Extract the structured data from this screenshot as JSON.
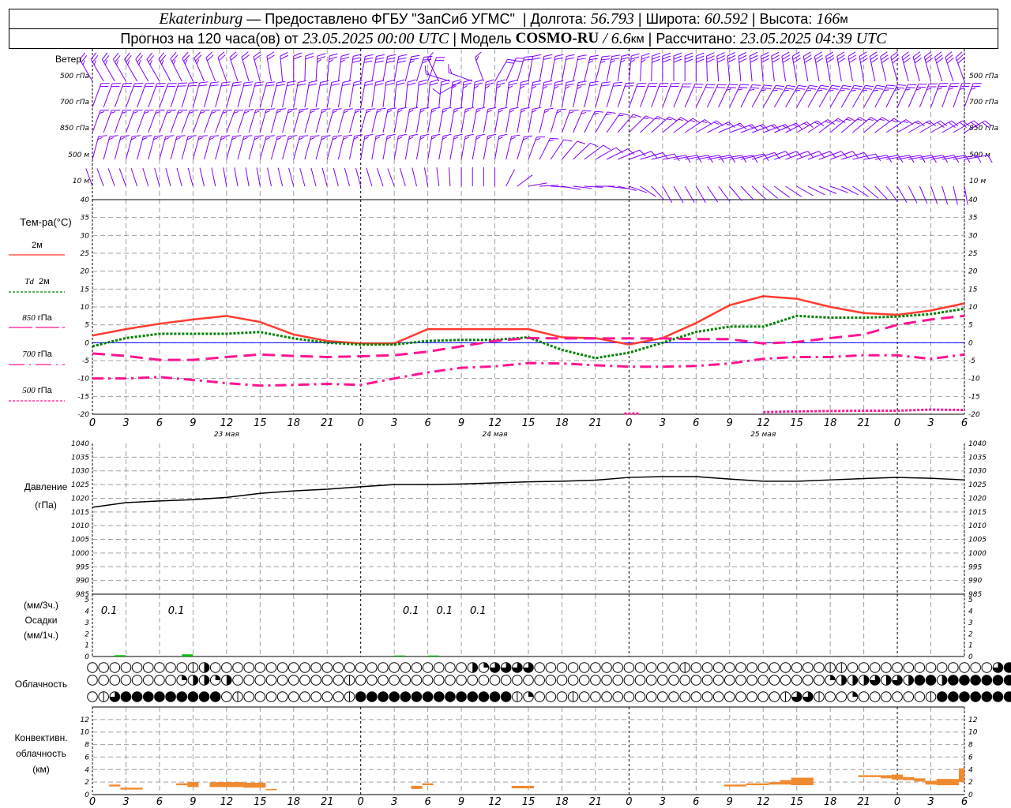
{
  "header": {
    "city": "Ekaterinburg",
    "provider": " — Предоставлено ФГБУ \"ЗапСиб УГМС\" ",
    "sep": " | ",
    "lon_label": "Долгота: ",
    "lon": "56.793",
    "lat_label": "Широта: ",
    "lat": "60.592",
    "alt_label": "Высота: ",
    "alt": "166",
    "alt_unit": "м",
    "forecast_prefix": "Прогноз на 120 часа(ов) от ",
    "forecast_start": "23.05.2025 00:00 UTC",
    "model_label": "Модель ",
    "model": "COSMO-RU",
    "model_sep": " / ",
    "resolution": "6.6",
    "res_unit": "км",
    "calc_label": "Рассчитано: ",
    "calc_time": "23.05.2025 04:39 UTC"
  },
  "colors": {
    "wind": "#8000ff",
    "t2m": "#ff3b2f",
    "td2m": "#008000",
    "t850": "#ff1493",
    "t700": "#ff1493",
    "t500": "#ff1493",
    "zero_line": "#0000ff",
    "precip": "#00c000",
    "convective": "#f08a30",
    "grid": "#a0a0a0"
  },
  "time_axis": {
    "hour_range": [
      0,
      78
    ],
    "tick_hours": [
      0,
      3,
      6,
      9,
      12,
      15,
      18,
      21,
      24,
      27,
      30,
      33,
      36,
      39,
      42,
      45,
      48,
      51,
      54,
      57,
      60,
      63,
      66,
      69,
      72,
      75,
      78
    ],
    "tick_labels": [
      "0",
      "3",
      "6",
      "9",
      "12",
      "15",
      "18",
      "21",
      "0",
      "3",
      "6",
      "9",
      "12",
      "15",
      "18",
      "21",
      "0",
      "3",
      "6",
      "9",
      "12",
      "15",
      "18",
      "21",
      "0",
      "3",
      "6"
    ],
    "day_boundaries": [
      24,
      48,
      72
    ],
    "days": [
      {
        "label": "23 мая",
        "hour": 12
      },
      {
        "label": "24 мая",
        "hour": 36
      },
      {
        "label": "25 мая",
        "hour": 60
      }
    ]
  },
  "wind": {
    "title": "Ветер",
    "levels": [
      {
        "label": "500 гПа",
        "dir": [
          330,
          330,
          330,
          335,
          340,
          345,
          0,
          5,
          10,
          10,
          20,
          240,
          30,
          10,
          10,
          15,
          5,
          0,
          0,
          355,
          355,
          350,
          350,
          350,
          345,
          345,
          340
        ],
        "feathers": [
          2.5,
          2.5,
          2.5,
          2.5,
          2,
          2,
          2,
          2.5,
          3,
          3,
          2,
          1,
          2,
          2,
          2,
          2.5,
          2.5,
          3,
          3,
          3,
          3,
          3,
          3,
          3,
          3,
          3,
          3
        ]
      },
      {
        "label": "700 гПа",
        "dir": [
          20,
          20,
          20,
          15,
          15,
          15,
          10,
          10,
          10,
          5,
          5,
          5,
          5,
          10,
          10,
          15,
          20,
          20,
          25,
          25,
          30,
          30,
          30,
          30,
          25,
          20,
          20
        ],
        "feathers": [
          2,
          2,
          2,
          2,
          2,
          2,
          2,
          2,
          2,
          2,
          2,
          2.5,
          2.5,
          2.5,
          2.5,
          2,
          2,
          2,
          2,
          2.5,
          2.5,
          2.5,
          2.5,
          2.5,
          2.5,
          2.5,
          2.5
        ]
      },
      {
        "label": "850 гПа",
        "dir": [
          20,
          20,
          20,
          20,
          20,
          15,
          15,
          15,
          15,
          10,
          10,
          10,
          10,
          10,
          20,
          30,
          45,
          50,
          60,
          70,
          70,
          60,
          50,
          50,
          60,
          60,
          60
        ],
        "feathers": [
          1.5,
          1.5,
          1.5,
          1.5,
          1.5,
          1.5,
          1.5,
          1.5,
          1.5,
          1.5,
          1.5,
          1.5,
          1.5,
          1.5,
          1.5,
          1.5,
          1.5,
          1.5,
          1.5,
          1.5,
          1.5,
          1.5,
          1.5,
          1.5,
          1.5,
          2,
          2
        ]
      },
      {
        "label": "500 м",
        "dir": [
          15,
          15,
          15,
          15,
          15,
          15,
          15,
          15,
          10,
          10,
          10,
          10,
          10,
          20,
          40,
          60,
          70,
          80,
          80,
          80,
          70,
          70,
          70,
          80,
          80,
          80,
          80
        ],
        "feathers": [
          1.5,
          1.5,
          1.5,
          1.5,
          1.5,
          1.5,
          1.5,
          1.5,
          1.5,
          1.5,
          1.5,
          1.5,
          1.5,
          1.5,
          1,
          1,
          1,
          1,
          1,
          1,
          1,
          1,
          1,
          1,
          1,
          1,
          1
        ]
      },
      {
        "label": "10 м",
        "dir": [
          340,
          340,
          345,
          345,
          350,
          350,
          345,
          345,
          345,
          340,
          350,
          0,
          0,
          80,
          100,
          90,
          110,
          150,
          150,
          140,
          130,
          120,
          110,
          130,
          150,
          160,
          170
        ],
        "feathers": [
          0,
          0,
          0,
          0,
          0,
          0,
          0,
          0,
          0,
          0,
          0,
          0,
          0,
          0,
          0,
          0,
          0,
          0,
          0,
          0,
          0,
          0,
          0,
          0,
          0,
          0,
          0
        ]
      }
    ]
  },
  "chart_data": [
    {
      "type": "line",
      "title": "Тем-ра(°C)",
      "ylim": [
        -20,
        40
      ],
      "yticks": [
        -20,
        -15,
        -10,
        -5,
        0,
        5,
        10,
        15,
        20,
        25,
        30,
        35,
        40
      ],
      "grid": true,
      "x": [
        0,
        3,
        6,
        9,
        12,
        15,
        18,
        21,
        24,
        27,
        30,
        33,
        36,
        39,
        42,
        45,
        48,
        51,
        54,
        57,
        60,
        63,
        66,
        69,
        72,
        75,
        78
      ],
      "series": [
        {
          "name": "2м",
          "key": "t2m",
          "style": "solid",
          "values": [
            2,
            3.8,
            5.3,
            6.5,
            7.5,
            5.8,
            2.3,
            0.5,
            -0.2,
            -0.2,
            3.8,
            3.8,
            3.8,
            3.8,
            1.5,
            1.3,
            -0.5,
            1.3,
            5.5,
            10.5,
            13,
            12.3,
            10,
            8.3,
            7.8,
            9,
            11
          ]
        },
        {
          "name": "Td 2м",
          "key": "td2m",
          "style": "dotted",
          "values": [
            -1,
            1.3,
            2.5,
            2.5,
            2.5,
            3,
            1.2,
            0,
            -0.5,
            -0.5,
            0.5,
            0.8,
            0.8,
            1.5,
            -2,
            -4.3,
            -2.8,
            0,
            3,
            4.5,
            4.5,
            7.5,
            7,
            7,
            7.3,
            8,
            9.5
          ]
        },
        {
          "name": "850 гПа",
          "key": "t850",
          "style": "longdash",
          "values": [
            -3,
            -3.7,
            -4.8,
            -4.8,
            -4,
            -3.3,
            -3.7,
            -4,
            -3.8,
            -3.5,
            -2.5,
            -1,
            0.5,
            1.3,
            1.2,
            1.2,
            1.2,
            1.2,
            1,
            1,
            -0.2,
            0.2,
            1.3,
            2.3,
            5,
            6.5,
            7.5
          ]
        },
        {
          "name": "700 гПа",
          "key": "t700",
          "style": "dashdot",
          "values": [
            -10,
            -10,
            -9.6,
            -10.4,
            -11.3,
            -12,
            -11.8,
            -11.5,
            -11.8,
            -10,
            -8.3,
            -7,
            -6.6,
            -5.7,
            -5.8,
            -6.3,
            -6.7,
            -6.7,
            -6.5,
            -5.8,
            -4.5,
            -4,
            -4,
            -3.5,
            -3.5,
            -4.5,
            -3.3
          ]
        },
        {
          "name": "500 гПа",
          "key": "t500",
          "style": "shortdash",
          "values": [
            null,
            null,
            null,
            null,
            null,
            null,
            null,
            null,
            null,
            null,
            null,
            null,
            null,
            null,
            null,
            null,
            -19.8,
            null,
            null,
            null,
            -19.4,
            -19.2,
            -19.1,
            -19,
            -19,
            -18.7,
            -18.8
          ]
        }
      ]
    },
    {
      "type": "line",
      "title": "Давление",
      "ylabel": "(гПа)",
      "ylim": [
        985,
        1040
      ],
      "yticks": [
        985,
        990,
        995,
        1000,
        1005,
        1010,
        1015,
        1020,
        1025,
        1030,
        1035,
        1040
      ],
      "grid": true,
      "x": [
        0,
        3,
        6,
        9,
        12,
        15,
        18,
        21,
        24,
        27,
        30,
        33,
        36,
        39,
        42,
        45,
        48,
        51,
        54,
        57,
        60,
        63,
        66,
        69,
        72,
        75,
        78
      ],
      "values": [
        1016.7,
        1018.4,
        1019,
        1019.5,
        1020.3,
        1021.8,
        1022.7,
        1023.3,
        1024.2,
        1025,
        1025,
        1025.2,
        1025.6,
        1026,
        1026.2,
        1026.6,
        1027.6,
        1027.9,
        1027.9,
        1027,
        1026.2,
        1026.2,
        1026.7,
        1027.2,
        1027.6,
        1027.3,
        1026.7
      ]
    },
    {
      "type": "bar",
      "title": "Осадки",
      "label_3h": "(мм/3ч.)",
      "label_1h": "(мм/1ч.)",
      "ylim": [
        0,
        5.5
      ],
      "yticks": [
        0,
        1,
        2,
        3,
        4,
        5
      ],
      "grid": true,
      "hourly": [
        {
          "hour": 2,
          "value": 0.05
        },
        {
          "hour": 8,
          "value": 0.12
        },
        {
          "hour": 27,
          "value": 0.02
        },
        {
          "hour": 30,
          "value": 0.02
        }
      ],
      "totals_3h": [
        {
          "from": 0,
          "to": 3,
          "label": "0.1"
        },
        {
          "from": 6,
          "to": 9,
          "label": "0.1"
        },
        {
          "from": 27,
          "to": 30,
          "label": "0.1"
        },
        {
          "from": 30,
          "to": 33,
          "label": "0.1"
        },
        {
          "from": 33,
          "to": 36,
          "label": "0.1"
        }
      ]
    },
    {
      "type": "table",
      "title": "Облачность",
      "encoding": "0 clear, 1 trace, 2 quarter, 3 half, 4 three-quarters, 5 overcast",
      "rows": [
        "0000000001300000000000000000000000324444000000000000010000000000001100000000000004555",
        "0000000023323000000000010000000000000000000000000000000000000000002333434355355555553",
        "0145555555550100000000015555555555555512000100000000000000000014410020000001555555554"
      ]
    },
    {
      "type": "bar",
      "title": "Конвективн.",
      "title2": "облачность",
      "ylabel": "(км)",
      "ylim": [
        0,
        14
      ],
      "yticks": [
        0,
        2,
        4,
        6,
        8,
        10,
        12
      ],
      "grid": true,
      "bars": [
        {
          "from": 1.5,
          "to": 2.5,
          "base": 1.3,
          "top": 1.6
        },
        {
          "from": 2.5,
          "to": 4.5,
          "base": 0.8,
          "top": 1.1
        },
        {
          "from": 7.5,
          "to": 8.5,
          "base": 1.5,
          "top": 1.8
        },
        {
          "from": 8.5,
          "to": 9.5,
          "base": 1.2,
          "top": 2.0
        },
        {
          "from": 10.5,
          "to": 13.5,
          "base": 1.2,
          "top": 2.0
        },
        {
          "from": 13.5,
          "to": 15.5,
          "base": 1.1,
          "top": 1.9
        },
        {
          "from": 15.5,
          "to": 16.5,
          "base": 0.7,
          "top": 0.9
        },
        {
          "from": 28.5,
          "to": 29.5,
          "base": 0.9,
          "top": 1.4
        },
        {
          "from": 29.5,
          "to": 30.5,
          "base": 1.5,
          "top": 1.8
        },
        {
          "from": 37.5,
          "to": 39.5,
          "base": 1.0,
          "top": 1.4
        },
        {
          "from": 56.5,
          "to": 58.5,
          "base": 1.3,
          "top": 1.6
        },
        {
          "from": 58.5,
          "to": 60.5,
          "base": 1.5,
          "top": 1.8
        },
        {
          "from": 60.5,
          "to": 61.5,
          "base": 1.6,
          "top": 2.0
        },
        {
          "from": 61.5,
          "to": 62.5,
          "base": 1.6,
          "top": 2.3
        },
        {
          "from": 62.5,
          "to": 64.5,
          "base": 1.5,
          "top": 2.7
        },
        {
          "from": 68.5,
          "to": 70.5,
          "base": 2.8,
          "top": 3.1
        },
        {
          "from": 70.5,
          "to": 71.5,
          "base": 2.6,
          "top": 3.1
        },
        {
          "from": 71.5,
          "to": 72.5,
          "base": 2.4,
          "top": 3.2
        },
        {
          "from": 72.5,
          "to": 73.5,
          "base": 2.3,
          "top": 2.8
        },
        {
          "from": 73.5,
          "to": 74.5,
          "base": 2.1,
          "top": 2.6
        },
        {
          "from": 74.5,
          "to": 75.5,
          "base": 1.6,
          "top": 2.2
        },
        {
          "from": 75.5,
          "to": 77.5,
          "base": 1.5,
          "top": 2.5
        },
        {
          "from": 77.5,
          "to": 78,
          "base": 2.0,
          "top": 4.2
        }
      ]
    }
  ],
  "legend": {
    "temp_title": "Тем-ра(°C)",
    "t2m": "2м",
    "td_sym": "Td",
    "td_lvl": "2м",
    "l850_num": "850",
    "l700_num": "700",
    "l500_num": "500",
    "hpa": "гПа"
  }
}
